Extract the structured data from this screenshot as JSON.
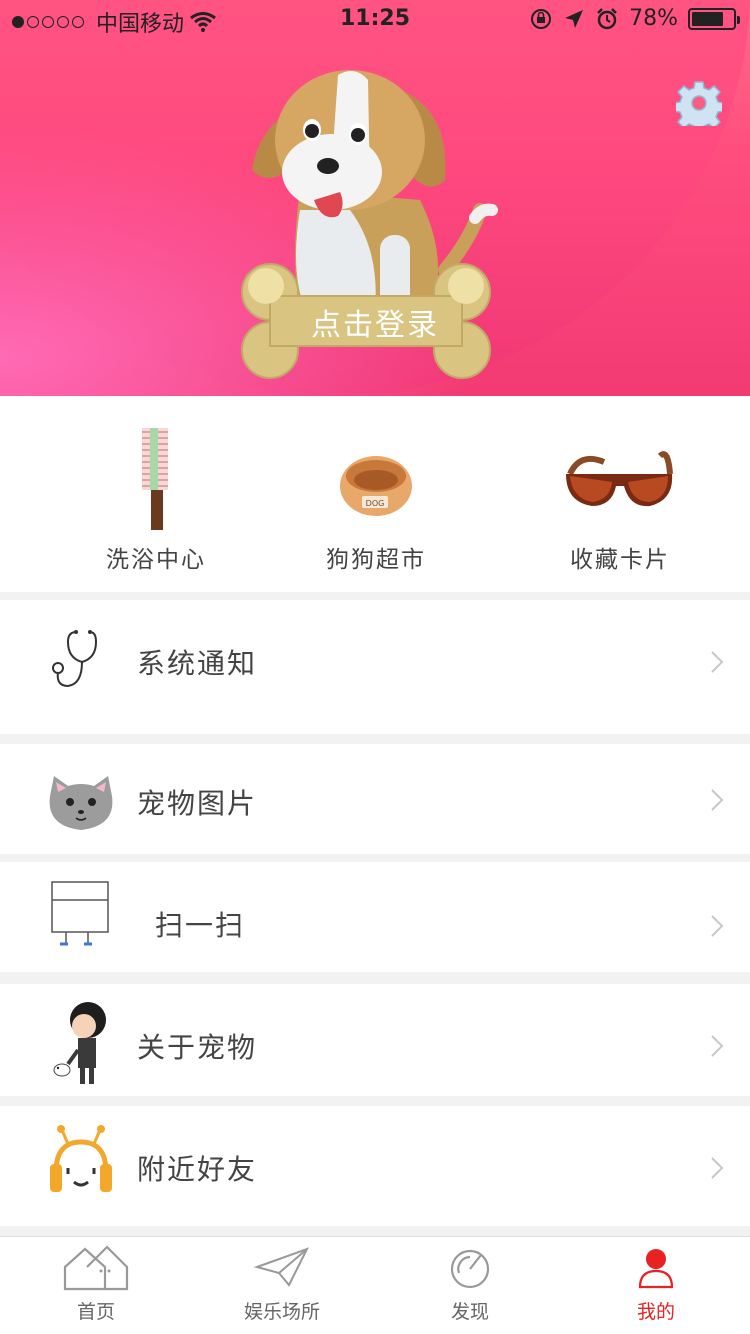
{
  "status_bar": {
    "signal_dots": 5,
    "signal_filled": 1,
    "carrier": "中国移动",
    "time": "11:25",
    "battery": "78%",
    "battery_level": 0.78
  },
  "header": {
    "login_label": "点击登录",
    "settings_icon": "gear-icon",
    "mascot": "dog-on-bone",
    "gradient": [
      "#ff6a88",
      "#f23a73"
    ]
  },
  "quick": [
    {
      "label": "洗浴中心",
      "icon": "comb-icon"
    },
    {
      "label": "狗狗超市",
      "icon": "dog-bowl-icon"
    },
    {
      "label": "收藏卡片",
      "icon": "sunglasses-icon"
    }
  ],
  "list": [
    {
      "label": "系统通知",
      "icon": "stethoscope-icon"
    },
    {
      "label": "宠物图片",
      "icon": "cat-face-icon"
    },
    {
      "label": "扫一扫",
      "icon": "scan-icon"
    },
    {
      "label": "关于宠物",
      "icon": "boy-with-dog-icon"
    },
    {
      "label": "附近好友",
      "icon": "robot-headphones-icon"
    }
  ],
  "tabbar": {
    "active_color": "#e82222",
    "items": [
      {
        "label": "首页",
        "icon": "house-icon"
      },
      {
        "label": "娱乐场所",
        "icon": "paper-plane-icon"
      },
      {
        "label": "发现",
        "icon": "compass-icon"
      },
      {
        "label": "我的",
        "icon": "user-icon",
        "active": true
      }
    ]
  }
}
